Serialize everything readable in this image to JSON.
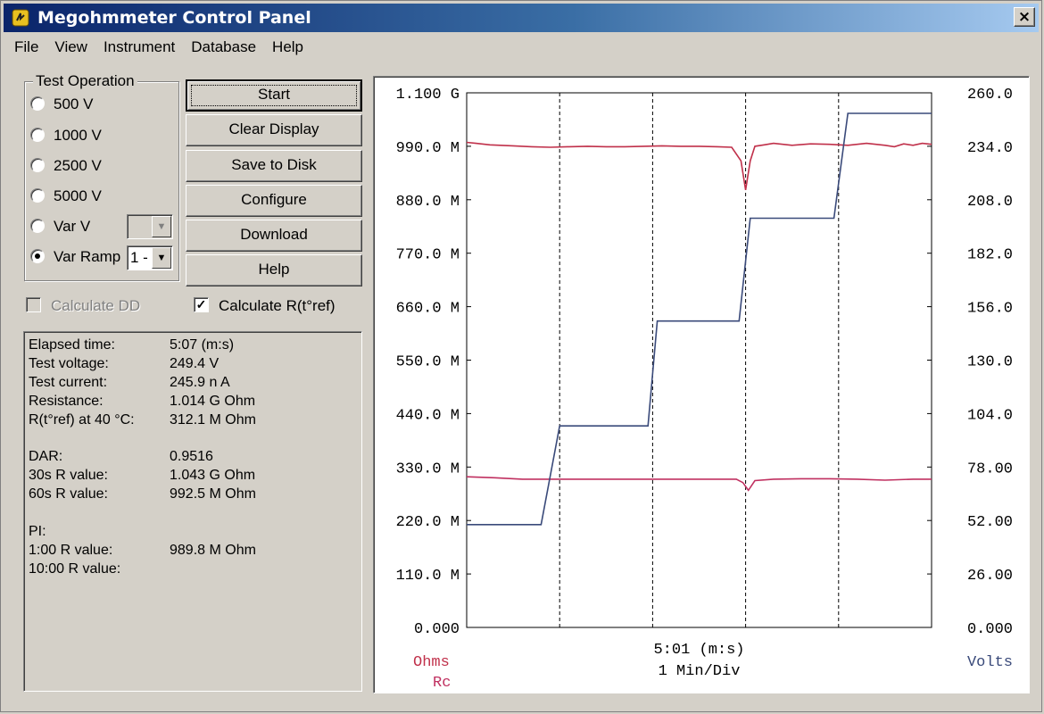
{
  "window": {
    "title": "Megohmmeter Control Panel",
    "close_glyph": "×"
  },
  "menu": [
    "File",
    "View",
    "Instrument",
    "Database",
    "Help"
  ],
  "test_operation": {
    "label": "Test Operation",
    "options": [
      {
        "label": "500 V",
        "selected": false
      },
      {
        "label": "1000 V",
        "selected": false
      },
      {
        "label": "2500 V",
        "selected": false
      },
      {
        "label": "5000 V",
        "selected": false
      },
      {
        "label": "Var V",
        "selected": false
      },
      {
        "label": "Var Ramp",
        "selected": true
      }
    ],
    "var_v_value": "",
    "var_ramp_value": "1 -"
  },
  "buttons": {
    "start": "Start",
    "clear": "Clear Display",
    "save": "Save to Disk",
    "configure": "Configure",
    "download": "Download",
    "help": "Help"
  },
  "checks": {
    "calc_dd": {
      "label": "Calculate DD",
      "checked": false,
      "enabled": false
    },
    "calc_rtref": {
      "label": "Calculate R(t°ref)",
      "checked": true,
      "enabled": true
    }
  },
  "status": [
    {
      "label": "Elapsed time:",
      "value": "5:07 (m:s)"
    },
    {
      "label": "Test voltage:",
      "value": "249.4  V"
    },
    {
      "label": "Test current:",
      "value": "245.9 n A"
    },
    {
      "label": "Resistance:",
      "value": "1.014 G Ohm"
    },
    {
      "label": "R(t°ref) at 40 °C:",
      "value": "312.1 M Ohm"
    },
    {
      "label": "DAR:",
      "value": "0.9516"
    },
    {
      "label": "30s R value:",
      "value": "1.043 G Ohm"
    },
    {
      "label": "60s R value:",
      "value": "992.5 M Ohm"
    },
    {
      "label": "PI:",
      "value": ""
    },
    {
      "label": "1:00 R value:",
      "value": "989.8 M Ohm"
    },
    {
      "label": "10:00 R value:",
      "value": ""
    }
  ],
  "colors": {
    "ohms": "#c0304a",
    "rc": "#c03060",
    "volts": "#3a4a7a"
  },
  "chart_data": {
    "type": "line",
    "x_readout": "5:01 (m:s)",
    "x_scale": "1 Min/Div",
    "x_range_minutes": [
      0,
      5
    ],
    "grid": "vertical dashed",
    "left_axis": {
      "label": "Ohms",
      "ticks": [
        "0.000",
        "110.0 M",
        "220.0 M",
        "330.0 M",
        "440.0 M",
        "550.0 M",
        "660.0 M",
        "770.0 M",
        "880.0 M",
        "990.0 M",
        "1.100 G"
      ],
      "range_ohm": [
        0,
        1100000000
      ]
    },
    "left_axis_secondary_label": "Rc",
    "right_axis": {
      "label": "Volts",
      "ticks": [
        "0.000",
        "26.00",
        "52.00",
        "78.00",
        "104.0",
        "130.0",
        "156.0",
        "182.0",
        "208.0",
        "234.0",
        "260.0"
      ],
      "range_v": [
        0,
        260
      ]
    },
    "series": [
      {
        "name": "Ohms",
        "axis": "left",
        "x_min": [
          0,
          0.1,
          0.25,
          0.5,
          0.7,
          0.9,
          1.1,
          1.3,
          1.5,
          1.7,
          1.9,
          2.1,
          2.3,
          2.5,
          2.7,
          2.85,
          2.95,
          3.0,
          3.05,
          3.1,
          3.2,
          3.3,
          3.5,
          3.7,
          3.9,
          4.1,
          4.3,
          4.5,
          4.6,
          4.7,
          4.8,
          4.9,
          5.0
        ],
        "y_mohm": [
          998,
          996,
          993,
          991,
          989,
          988,
          989,
          990,
          989,
          989,
          990,
          991,
          990,
          990,
          989,
          988,
          960,
          900,
          960,
          990,
          993,
          996,
          992,
          995,
          994,
          992,
          996,
          992,
          989,
          995,
          992,
          996,
          994
        ]
      },
      {
        "name": "Rc",
        "axis": "left",
        "x_min": [
          0,
          0.3,
          0.6,
          0.9,
          1.2,
          1.5,
          1.8,
          2.1,
          2.4,
          2.7,
          2.9,
          2.97,
          3.03,
          3.1,
          3.3,
          3.6,
          3.9,
          4.2,
          4.5,
          4.8,
          5.0
        ],
        "y_mohm": [
          310,
          308,
          305,
          305,
          305,
          305,
          305,
          305,
          305,
          305,
          305,
          298,
          282,
          302,
          305,
          306,
          306,
          305,
          303,
          305,
          305
        ]
      },
      {
        "name": "Volts",
        "axis": "right",
        "x_min": [
          0,
          0.8,
          1.0,
          1.95,
          2.05,
          2.93,
          3.05,
          3.95,
          4.1,
          5.0
        ],
        "y_v": [
          50,
          50,
          98,
          98,
          149,
          149,
          199,
          199,
          250,
          250
        ]
      }
    ]
  }
}
